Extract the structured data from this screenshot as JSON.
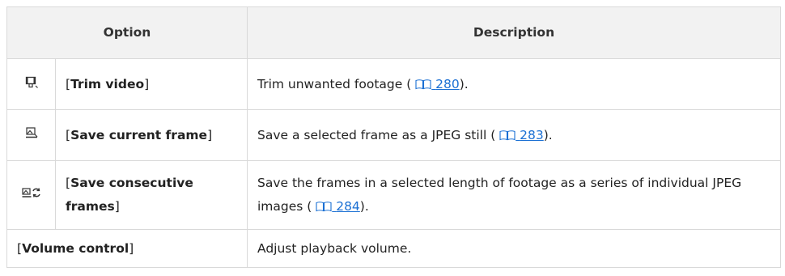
{
  "table": {
    "headers": {
      "option": "Option",
      "description": "Description"
    },
    "rows": [
      {
        "icon": "trim-video-icon",
        "name": "Trim video",
        "desc_before": "Trim unwanted footage (",
        "ref": "280",
        "desc_after": ")."
      },
      {
        "icon": "save-frame-icon",
        "name": "Save current frame",
        "desc_before": "Save a selected frame as a JPEG still (",
        "ref": "283",
        "desc_after": ")."
      },
      {
        "icon": "save-consecutive-frames-icon",
        "name": "Save consecutive frames",
        "desc_before": "Save the frames in a selected length of footage as a series of individual JPEG images (",
        "ref": "284",
        "desc_after": ")."
      },
      {
        "name": "Volume control",
        "desc": "Adjust playback volume."
      }
    ]
  },
  "colors": {
    "link": "#1a6fd3",
    "header_bg": "#f2f2f2",
    "border": "#d9d9d9"
  }
}
